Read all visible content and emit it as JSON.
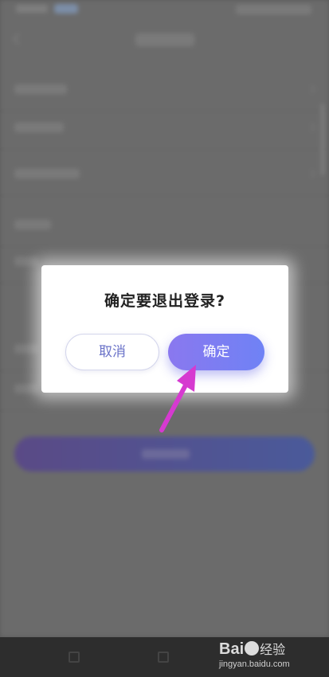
{
  "dialog": {
    "title": "确定要退出登录?",
    "cancel_label": "取消",
    "confirm_label": "确定"
  },
  "watermark": {
    "brand": "Bai",
    "brand_suffix": "经验",
    "url": "jingyan.baidu.com"
  },
  "colors": {
    "accent_start": "#8a78ef",
    "accent_end": "#6f82f5",
    "annotation_arrow": "#d63ad0",
    "overlay": "#5a5a5a"
  },
  "icons": [
    "back-arrow-icon",
    "chevron-right-icon",
    "annotation-arrow-icon",
    "paw-icon"
  ]
}
